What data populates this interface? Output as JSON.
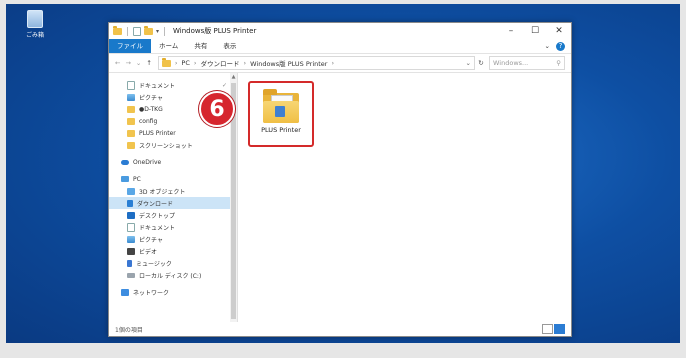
{
  "desktop": {
    "icon_label": "ごみ箱"
  },
  "window": {
    "title": "Windows版 PLUS Printer",
    "controls": {
      "minimize": "–",
      "maximize": "☐",
      "close": "✕"
    }
  },
  "ribbon": {
    "tabs": [
      "ファイル",
      "ホーム",
      "共有",
      "表示"
    ],
    "collapse": "⌄",
    "help": "?"
  },
  "address": {
    "back": "←",
    "forward": "→",
    "recent": "⌄",
    "up": "↑",
    "crumbs": [
      "PC",
      "ダウンロード",
      "Windows版 PLUS Printer"
    ],
    "dropdown": "⌄",
    "refresh": "↻",
    "search_placeholder": "Windows...",
    "search_icon": "⚲"
  },
  "sidebar": {
    "items": [
      {
        "label": "ドキュメント",
        "icon": "document-icon",
        "pinned": "✓"
      },
      {
        "label": "ピクチャ",
        "icon": "pictures-icon"
      },
      {
        "label": "●D-TKG",
        "icon": "folder-icon"
      },
      {
        "label": "config",
        "icon": "folder-icon"
      },
      {
        "label": "PLUS Printer",
        "icon": "folder-icon"
      },
      {
        "label": "スクリーンショット",
        "icon": "folder-icon"
      },
      {
        "label": "OneDrive",
        "icon": "onedrive-icon"
      },
      {
        "label": "PC",
        "icon": "pc-icon"
      },
      {
        "label": "3D オブジェクト",
        "icon": "3d-objects-icon"
      },
      {
        "label": "ダウンロード",
        "icon": "downloads-icon",
        "selected": true
      },
      {
        "label": "デスクトップ",
        "icon": "desktop-icon"
      },
      {
        "label": "ドキュメント",
        "icon": "document-icon"
      },
      {
        "label": "ピクチャ",
        "icon": "pictures-icon"
      },
      {
        "label": "ビデオ",
        "icon": "videos-icon"
      },
      {
        "label": "ミュージック",
        "icon": "music-icon"
      },
      {
        "label": "ローカル ディスク (C:)",
        "icon": "drive-icon"
      },
      {
        "label": "ネットワーク",
        "icon": "network-icon"
      }
    ]
  },
  "content": {
    "items": [
      {
        "name": "PLUS Printer",
        "icon": "folder-icon",
        "highlighted": true
      }
    ]
  },
  "annotation": {
    "step_number": "6",
    "color": "#d6262e"
  },
  "status": {
    "item_count": "1個の項目"
  },
  "colors": {
    "accent": "#1979ca",
    "selection": "#cce4f7",
    "highlight_border": "#d42a2a",
    "desktop": "#0e4fa3"
  }
}
